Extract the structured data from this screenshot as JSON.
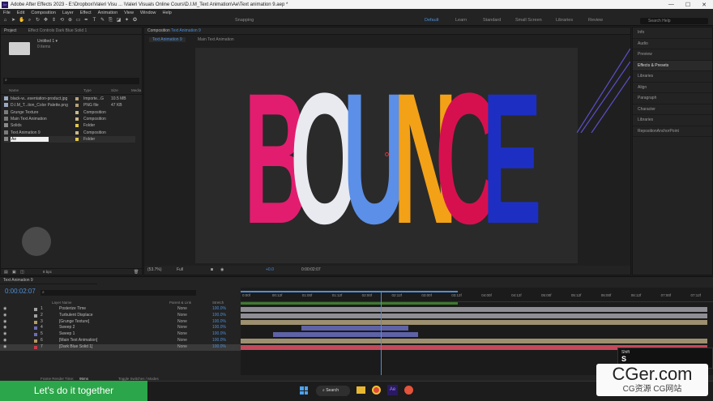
{
  "window": {
    "title": "Adobe After Effects 2023 - E:\\Dropbox\\Valeri Visu ... \\Valeri Visuals Online Cours\\D.I.M_Text Animation\\Ae\\Text animation 9.aep *",
    "minimize": "—",
    "maximize": "☐",
    "close": "✕"
  },
  "menu": [
    "File",
    "Edit",
    "Composition",
    "Layer",
    "Effect",
    "Animation",
    "View",
    "Window",
    "Help"
  ],
  "workspaces": {
    "snapping": "Snapping",
    "items": [
      "Default",
      "Learn",
      "Standard",
      "Small Screen",
      "Libraries",
      "Review"
    ],
    "search_placeholder": "Search Help"
  },
  "project": {
    "tab": "Project",
    "effect_controls": "Effect Controls  Dark Blue Solid 1",
    "item_name": "Untitled 1 ▾",
    "item_count": "0 items",
    "search_placeholder": "",
    "columns": [
      "Name",
      "Type",
      "Size",
      "Media"
    ],
    "rows": [
      {
        "name": "black-w...esentation-product.jpg",
        "type": "Importe...G",
        "size": "10.5 MB",
        "color": "#b9a37a"
      },
      {
        "name": "D.I.M_T...tion_Color Palette.png",
        "type": "PNG file",
        "size": "47 KB",
        "color": "#b9a37a"
      },
      {
        "name": "Grunge Texture",
        "type": "Composition",
        "size": "",
        "color": "#c9b98a"
      },
      {
        "name": "Main Text Animation",
        "type": "Composition",
        "size": "",
        "color": "#c9b98a"
      },
      {
        "name": "Solids",
        "type": "Folder",
        "size": "",
        "color": "#e1c84a"
      },
      {
        "name": "Text Animation 9",
        "type": "Composition",
        "size": "",
        "color": "#c9b98a"
      },
      {
        "name": "Ae",
        "type": "Folder",
        "size": "",
        "color": "#e1c84a"
      }
    ],
    "bpc": "8 bpc"
  },
  "composition": {
    "tab_prefix": "Composition",
    "tab_name": "Text Animation 9",
    "subtabs": [
      "Text Animation 9",
      "Main Text Animation"
    ],
    "zoom": "(53.7%)",
    "resolution": "Full",
    "timecode": "0:00:02:07",
    "exposure": "+0.0",
    "letters": [
      {
        "ch": "B",
        "color": "#e21d6f"
      },
      {
        "ch": "O",
        "color": "#e9eaf0"
      },
      {
        "ch": "U",
        "color": "#5b8fe8"
      },
      {
        "ch": "N",
        "color": "#f3a117"
      },
      {
        "ch": "C",
        "color": "#d6104f"
      },
      {
        "ch": "E",
        "color": "#1d2fc2"
      }
    ]
  },
  "right_panels": [
    "Info",
    "Audio",
    "Preview",
    "Effects & Presets",
    "Libraries",
    "Align",
    "Paragraph",
    "Character",
    "Libraries",
    "RepositionAnchorPoint"
  ],
  "timeline": {
    "tab": "Text Animation 9",
    "timecode": "0:00:02:07",
    "frame_rate": "00062 (25.00 fps)",
    "col_layer": "Layer Name",
    "col_parent": "Parent & Link",
    "col_stretch": "Stretch",
    "layers": [
      {
        "num": "1",
        "name": "Posterize Time",
        "parent": "None",
        "stretch": "100.0%",
        "color": "#a1a1a1",
        "bar": [
          0,
          1
        ],
        "barcolor": "#8e8e94"
      },
      {
        "num": "2",
        "name": "Turbulent Displace",
        "parent": "None",
        "stretch": "100.0%",
        "color": "#a1a1a1",
        "bar": [
          0,
          1
        ],
        "barcolor": "#8e8e94"
      },
      {
        "num": "3",
        "name": "[Grunge Texture]",
        "parent": "None",
        "stretch": "100.0%",
        "color": "#b59a64",
        "bar": [
          0,
          1
        ],
        "barcolor": "#9d9070"
      },
      {
        "num": "4",
        "name": "Sweep 2",
        "parent": "None",
        "stretch": "100.0%",
        "color": "#6c6cb8",
        "bar": [
          0.13,
          0.36
        ],
        "barcolor": "#5e62a6"
      },
      {
        "num": "5",
        "name": "Sweep 1",
        "parent": "None",
        "stretch": "100.0%",
        "color": "#6c6cb8",
        "bar": [
          0.07,
          0.38
        ],
        "barcolor": "#5e62a6"
      },
      {
        "num": "6",
        "name": "[Main Text Animation]",
        "parent": "None",
        "stretch": "100.0%",
        "color": "#b59a64",
        "bar": [
          0,
          1
        ],
        "barcolor": "#9d9070"
      },
      {
        "num": "7",
        "name": "[Dark Blue Solid 1]",
        "parent": "None",
        "stretch": "100.0%",
        "color": "#c73a4a",
        "bar": [
          0,
          1
        ],
        "barcolor": "#c4495a"
      }
    ],
    "ruler": [
      "0:00f",
      "00:12f",
      "01:00f",
      "01:12f",
      "02:00f",
      "02:12f",
      "03:00f",
      "03:12f",
      "04:00f",
      "04:12f",
      "05:00f",
      "05:12f",
      "06:00f",
      "06:12f",
      "07:00f",
      "07:12f"
    ],
    "render_time_label": "Frame Render Time:",
    "render_time": "95ms",
    "toggle": "Toggle Switches / Modes"
  },
  "banner": "Let's do it together",
  "taskbar": {
    "search": "Search",
    "ae": "Ae"
  },
  "shift_overlay": {
    "label": "Shift",
    "key": "S"
  },
  "watermark": {
    "main": "CGer.com",
    "sub": "CG资源  CG网站"
  }
}
